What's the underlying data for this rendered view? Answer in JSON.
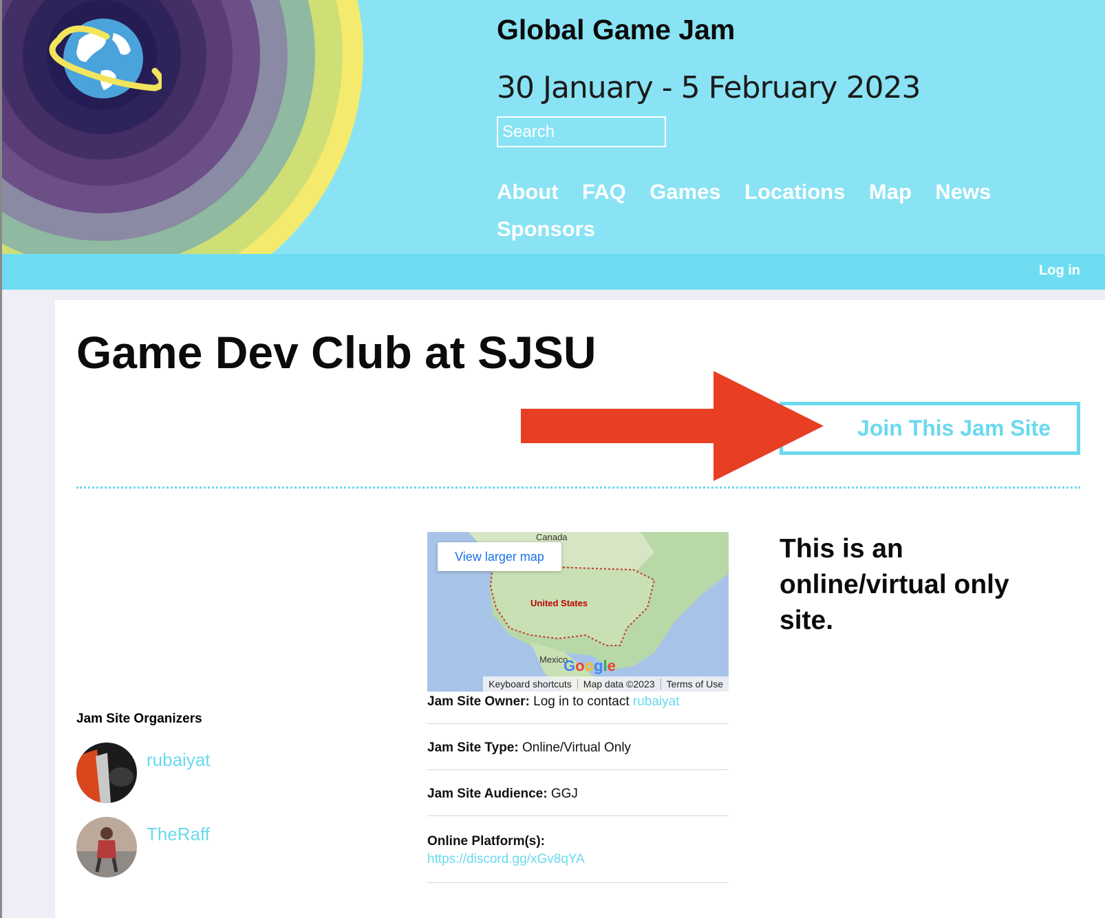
{
  "header": {
    "title": "Global Game Jam",
    "dates": "30 January - 5 February 2023",
    "search_placeholder": "Search",
    "nav": [
      "About",
      "FAQ",
      "Games",
      "Locations",
      "Map",
      "News",
      "Sponsors"
    ],
    "login": "Log in",
    "colors": {
      "header_bg": "#89e3f4",
      "subbar_bg": "#6fddf1",
      "accent": "#6ad9ef"
    }
  },
  "page": {
    "title": "Game Dev Club at SJSU",
    "join_button": "Join This Jam Site",
    "virtual_note": "This is an online/virtual only site."
  },
  "map": {
    "view_larger": "View larger map",
    "labels": {
      "canada": "Canada",
      "us": "United States",
      "mexico": "Mexico"
    },
    "logo": "Google",
    "attribution": [
      "Keyboard shortcuts",
      "Map data ©2023",
      "Terms of Use"
    ]
  },
  "organizers": {
    "heading": "Jam Site Organizers",
    "list": [
      {
        "name": "rubaiyat"
      },
      {
        "name": "TheRaff"
      }
    ]
  },
  "info": {
    "owner_label": "Jam Site Owner:",
    "owner_text": "Log in to contact",
    "owner_name": "rubaiyat",
    "type_label": "Jam Site Type:",
    "type_value": "Online/Virtual Only",
    "audience_label": "Jam Site Audience:",
    "audience_value": "GGJ",
    "platform_label": "Online Platform(s):",
    "platform_link": "https://discord.gg/xGv8qYA"
  }
}
